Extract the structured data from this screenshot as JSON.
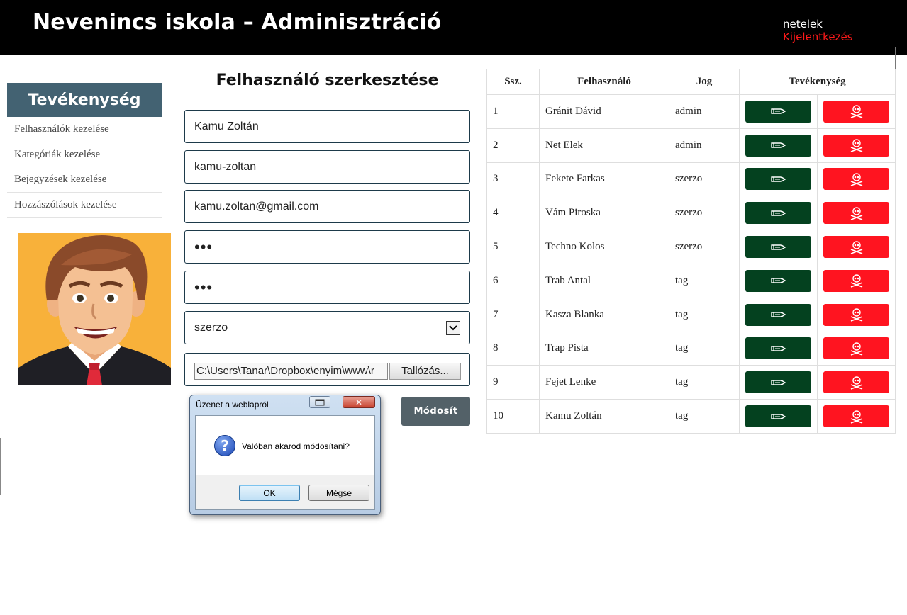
{
  "header": {
    "title": "Nevenincs iskola – Adminisztráció",
    "user_name": "netelek",
    "logout_label": "Kijelentkezés"
  },
  "sidebar": {
    "heading": "Tevékenység",
    "items": [
      {
        "label": "Felhasználók kezelése"
      },
      {
        "label": "Kategóriák kezelése"
      },
      {
        "label": "Bejegyzések kezelése"
      },
      {
        "label": "Hozzászólások kezelése"
      }
    ]
  },
  "form": {
    "title": "Felhasználó szerkesztése",
    "fullname": "Kamu Zoltán",
    "username": "kamu-zoltan",
    "email": "kamu.zoltan@gmail.com",
    "password": "•••",
    "password_confirm": "•••",
    "role_selected": "szerzo",
    "file_path": "C:\\Users\\Tanar\\Dropbox\\enyim\\www\\r",
    "browse_label": "Tallózás...",
    "submit_label": "Módosít"
  },
  "table": {
    "headers": [
      "Ssz.",
      "Felhasználó",
      "Jog",
      "Tevékenység"
    ],
    "rows": [
      {
        "num": "1",
        "name": "Gránit Dávid",
        "role": "admin"
      },
      {
        "num": "2",
        "name": "Net Elek",
        "role": "admin"
      },
      {
        "num": "3",
        "name": "Fekete Farkas",
        "role": "szerzo"
      },
      {
        "num": "4",
        "name": "Vám Piroska",
        "role": "szerzo"
      },
      {
        "num": "5",
        "name": "Techno Kolos",
        "role": "szerzo"
      },
      {
        "num": "6",
        "name": "Trab Antal",
        "role": "tag"
      },
      {
        "num": "7",
        "name": "Kasza Blanka",
        "role": "tag"
      },
      {
        "num": "8",
        "name": "Trap Pista",
        "role": "tag"
      },
      {
        "num": "9",
        "name": "Fejet Lenke",
        "role": "tag"
      },
      {
        "num": "10",
        "name": "Kamu Zoltán",
        "role": "tag"
      }
    ],
    "edit_icon": "pencil-icon",
    "delete_icon": "skull-crossbones-icon"
  },
  "dialog": {
    "title": "Üzenet a weblapról",
    "message": "Valóban akarod módosítani?",
    "ok_label": "OK",
    "cancel_label": "Mégse",
    "icon": "question-icon"
  },
  "colors": {
    "header_bg": "#000000",
    "sidebar_head_bg": "#436272",
    "edit_button": "#04411f",
    "delete_button": "#ff1420",
    "logout_text": "#ff1a1a",
    "avatar_bg": "#f8b13a"
  }
}
